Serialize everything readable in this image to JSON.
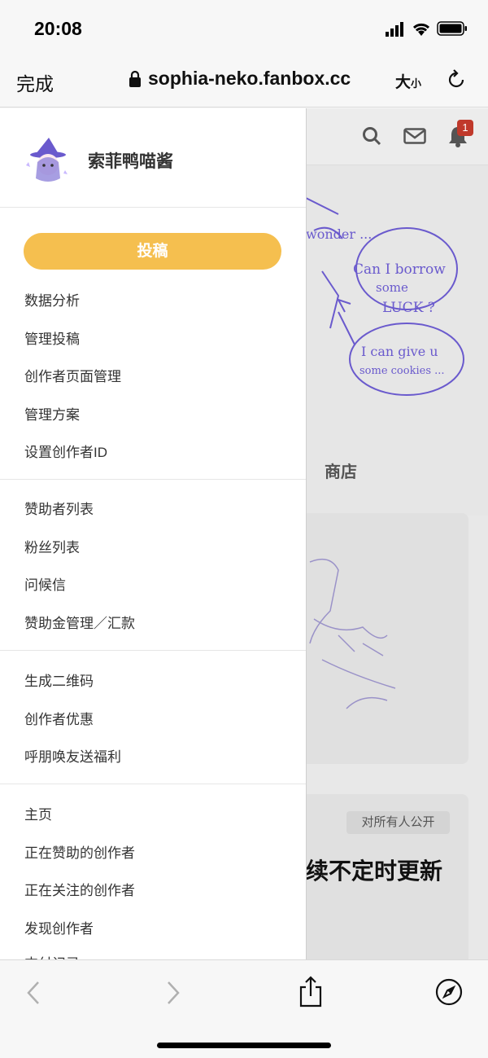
{
  "status_bar": {
    "time": "20:08"
  },
  "url_bar": {
    "done_label": "完成",
    "url": "sophia-neko.fanbox.cc",
    "text_size_big": "大",
    "text_size_small": "小"
  },
  "background_page": {
    "notification_count": "1",
    "tab_shop": "商店",
    "visibility_badge": "对所有人公开",
    "post_title_fragment": "续不定时更新"
  },
  "drawer": {
    "profile_name": "索菲鸭喵酱",
    "post_button": "投稿",
    "group1": [
      "数据分析",
      "管理投稿",
      "创作者页面管理",
      "管理方案",
      "设置创作者ID"
    ],
    "group2": [
      "赞助者列表",
      "粉丝列表",
      "问候信",
      "赞助金管理／汇款"
    ],
    "group3": [
      "生成二维码",
      "创作者优惠",
      "呼朋唤友送福利"
    ],
    "group4": [
      "主页",
      "正在赞助的创作者",
      "正在关注的创作者",
      "发现创作者",
      "支付记录"
    ]
  },
  "colors": {
    "accent": "#f5bf4f",
    "badge": "#c0392b"
  }
}
